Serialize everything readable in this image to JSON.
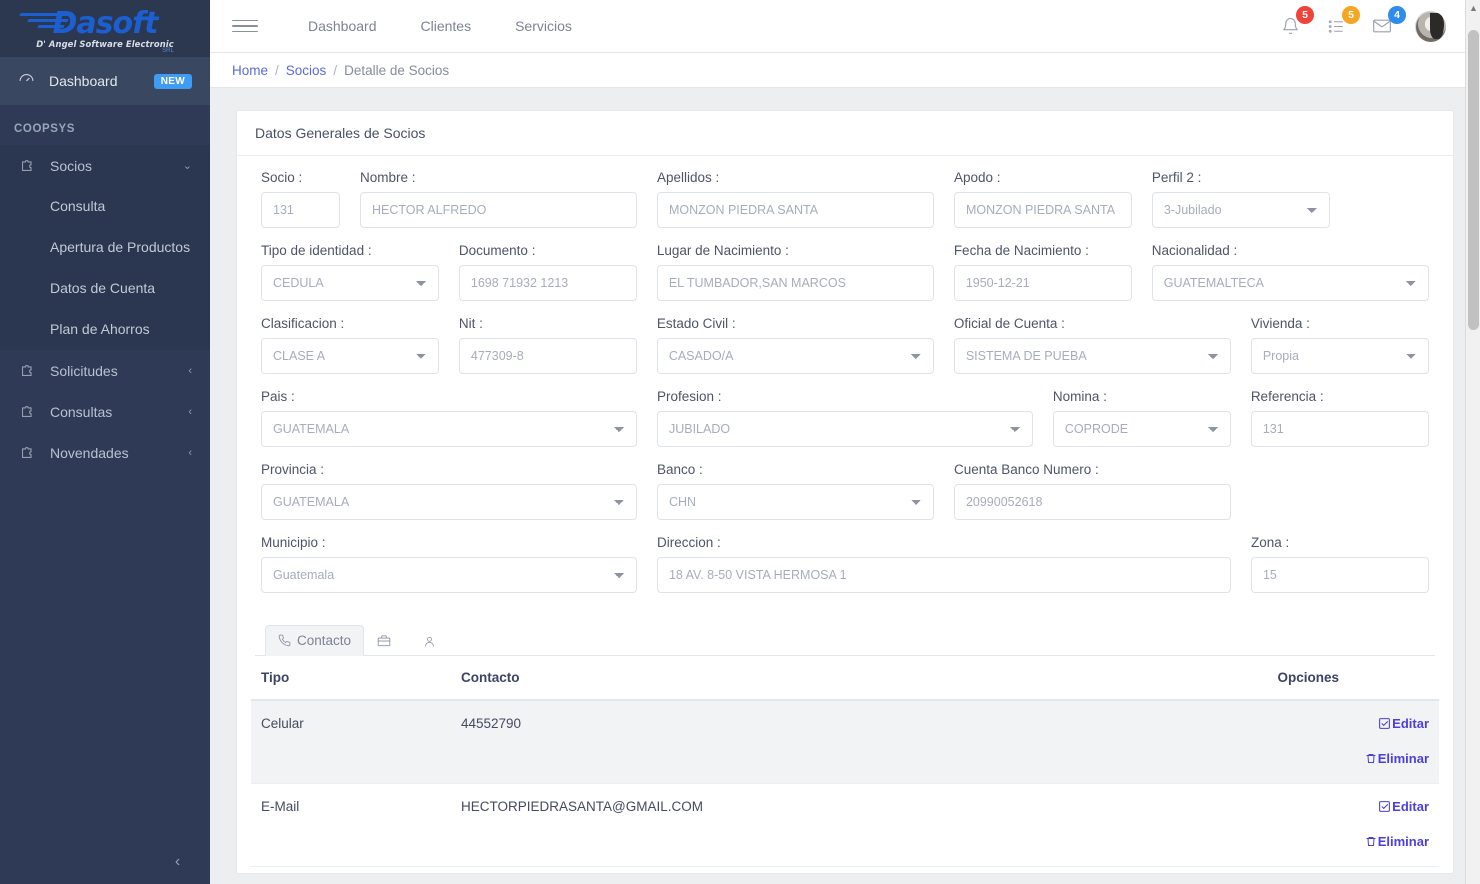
{
  "brand": {
    "name": "Dasoft",
    "tagline": "D' Angel Software Electronic",
    "suffix": "SRL"
  },
  "sidebar": {
    "dashboard": {
      "label": "Dashboard",
      "badge": "NEW",
      "icon": "dashboard-icon"
    },
    "section_title": "COOPSYS",
    "groups": [
      {
        "label": "Socios",
        "icon": "puzzle-icon",
        "caret": "⌄",
        "open": true,
        "children": [
          {
            "label": "Consulta"
          },
          {
            "label": "Apertura de Productos"
          },
          {
            "label": "Datos de Cuenta"
          },
          {
            "label": "Plan de Ahorros"
          }
        ]
      },
      {
        "label": "Solicitudes",
        "icon": "puzzle-icon",
        "caret": "‹"
      },
      {
        "label": "Consultas",
        "icon": "puzzle-icon",
        "caret": "‹"
      },
      {
        "label": "Novendades",
        "icon": "puzzle-icon",
        "caret": "‹"
      }
    ],
    "collapse": "‹"
  },
  "topbar": {
    "menu_icon": "hamburger-icon",
    "nav": [
      {
        "label": "Dashboard"
      },
      {
        "label": "Clientes"
      },
      {
        "label": "Servicios"
      }
    ],
    "notifications": [
      {
        "icon": "bell-icon",
        "count": "5",
        "color": "#f0433a"
      },
      {
        "icon": "tasks-icon",
        "count": "5",
        "color": "#f5a623"
      },
      {
        "icon": "envelope-icon",
        "count": "4",
        "color": "#2f8ced"
      }
    ],
    "avatar": "user-avatar"
  },
  "breadcrumb": {
    "home": "Home",
    "sep1": "/",
    "socios": "Socios",
    "sep2": "/",
    "current": "Detalle de Socios"
  },
  "card": {
    "title": "Datos Generales de Socios"
  },
  "form": {
    "socio": {
      "label": "Socio :",
      "value": "131"
    },
    "nombre": {
      "label": "Nombre :",
      "value": "HECTOR ALFREDO"
    },
    "apellidos": {
      "label": "Apellidos :",
      "value": "MONZON PIEDRA SANTA"
    },
    "apodo": {
      "label": "Apodo :",
      "value": "MONZON PIEDRA SANTA"
    },
    "perfil2": {
      "label": "Perfil 2 :",
      "value": "3-Jubilado"
    },
    "tipo_ident": {
      "label": "Tipo de identidad :",
      "value": "CEDULA"
    },
    "documento": {
      "label": "Documento :",
      "value": "1698 71932 1213"
    },
    "lugar_nac": {
      "label": "Lugar de Nacimiento :",
      "value": "EL TUMBADOR,SAN MARCOS"
    },
    "fecha_nac": {
      "label": "Fecha de Nacimiento :",
      "value": "1950-12-21"
    },
    "nacionalidad": {
      "label": "Nacionalidad :",
      "value": "GUATEMALTECA"
    },
    "clasificacion": {
      "label": "Clasificacion :",
      "value": "CLASE A"
    },
    "nit": {
      "label": "Nit :",
      "value": "477309-8"
    },
    "estado_civil": {
      "label": "Estado Civil :",
      "value": "CASADO/A"
    },
    "oficial": {
      "label": "Oficial de Cuenta :",
      "value": "SISTEMA DE PUEBA"
    },
    "vivienda": {
      "label": "Vivienda :",
      "value": "Propia"
    },
    "pais": {
      "label": "Pais :",
      "value": "GUATEMALA"
    },
    "profesion": {
      "label": "Profesion :",
      "value": "JUBILADO"
    },
    "nomina": {
      "label": "Nomina :",
      "value": "COPRODE"
    },
    "referencia": {
      "label": "Referencia :",
      "value": "131"
    },
    "provincia": {
      "label": "Provincia :",
      "value": "GUATEMALA"
    },
    "banco": {
      "label": "Banco :",
      "value": "CHN"
    },
    "cuenta_banco": {
      "label": "Cuenta Banco Numero :",
      "value": "20990052618"
    },
    "municipio": {
      "label": "Municipio :",
      "value": "Guatemala"
    },
    "direccion": {
      "label": "Direccion :",
      "value": "18 AV. 8-50 VISTA HERMOSA 1"
    },
    "zona": {
      "label": "Zona :",
      "value": "15"
    }
  },
  "tabs": [
    {
      "label": "Contacto",
      "icon": "phone-icon",
      "active": true
    },
    {
      "label": "",
      "icon": "briefcase-icon",
      "active": false
    },
    {
      "label": "",
      "icon": "person-icon",
      "active": false
    }
  ],
  "contacts": {
    "columns": [
      "Tipo",
      "Contacto",
      "Opciones"
    ],
    "rows": [
      {
        "tipo": "Celular",
        "contacto": "44552790",
        "options": [
          {
            "label": "Editar",
            "icon": "edit-icon"
          },
          {
            "label": "Eliminar",
            "icon": "trash-icon"
          }
        ]
      },
      {
        "tipo": "E-Mail",
        "contacto": "HECTORPIEDRASANTA@GMAIL.COM",
        "options": [
          {
            "label": "Editar",
            "icon": "edit-icon"
          },
          {
            "label": "Eliminar",
            "icon": "trash-icon"
          }
        ]
      }
    ]
  },
  "colors": {
    "sidebar": "#2f3b56",
    "link": "#5b6ae0",
    "action_link": "#4b3fe0",
    "badge_new": "#3f9cf5"
  }
}
